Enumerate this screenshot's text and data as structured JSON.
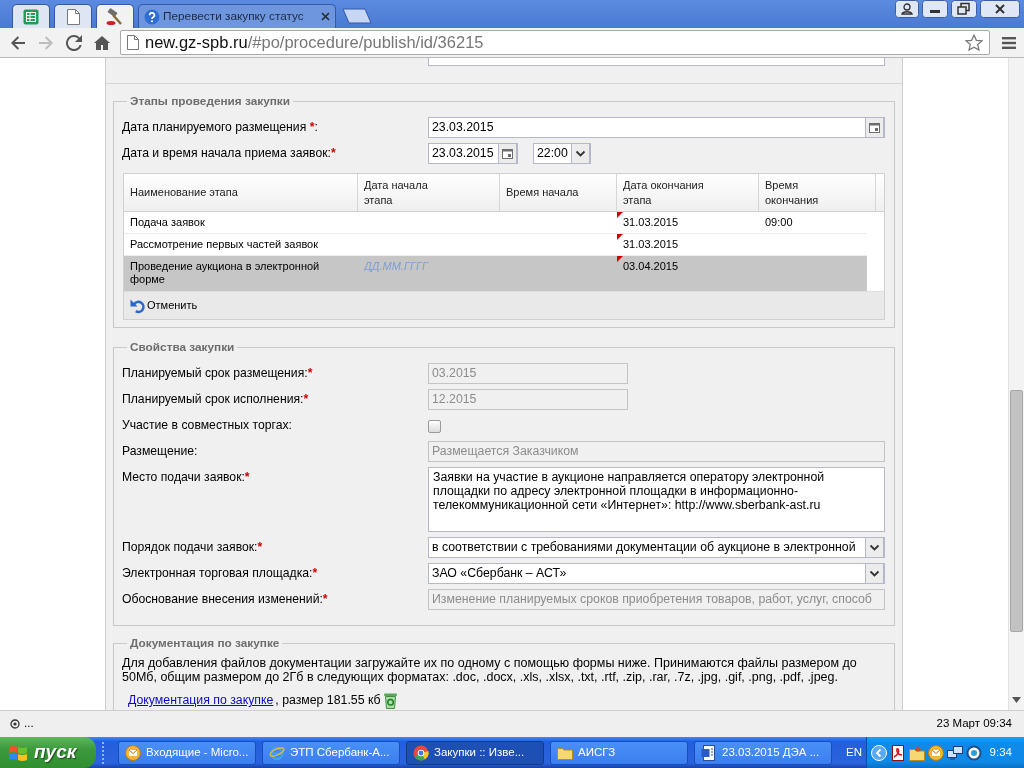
{
  "browser": {
    "tabs": [
      {
        "pinned": true,
        "selected": false
      },
      {
        "pinned": true,
        "selected": false
      },
      {
        "pinned": true,
        "selected": true
      },
      {
        "title": "Перевести закупку статус",
        "pinned": false,
        "selected": false
      }
    ],
    "navigation": {
      "back_disabled": false,
      "forward_disabled": true
    },
    "address": {
      "domain": "new.gz-spb.ru",
      "path": "/#po/procedure/publish/id/36215"
    }
  },
  "stages": {
    "legend": "Этапы проведения закупки",
    "fields": [
      {
        "kind": "date",
        "label": "Дата планируемого размещения",
        "required_mark": "*",
        "label_end": ":",
        "value": "23.03.2015"
      },
      {
        "kind": "datetime",
        "label": "Дата и время начала приема заявок:",
        "required_mark": "*",
        "value": "23.03.2015",
        "time": "22:00"
      }
    ],
    "table": {
      "columns": [
        "Наименование этапа",
        "Дата начала этапа",
        "Время начала",
        "Дата окончания этапа",
        "Время окончания"
      ],
      "rows": [
        {
          "name": "Подача заявок",
          "end_date": "31.03.2015",
          "end_time": "09:00",
          "edited": true,
          "selected": false
        },
        {
          "name": "Рассмотрение первых частей заявок",
          "end_date": "31.03.2015",
          "edited": true,
          "selected": false
        },
        {
          "name": "Проведение аукциона в электронной форме",
          "start_date_placeholder": "ДД.ММ.ГГГГ",
          "end_date": "03.04.2015",
          "edited": true,
          "selected": true
        }
      ]
    },
    "cancel_button": "Отменить"
  },
  "properties": {
    "legend": "Свойства закупки",
    "fields": [
      {
        "kind": "short_text",
        "label": "Планируемый срок размещения:",
        "required_mark": "*",
        "value": "03.2015",
        "disabled": true
      },
      {
        "kind": "short_text",
        "label": "Планируемый срок исполнения:",
        "required_mark": "*",
        "value": "12.2015",
        "disabled": true
      },
      {
        "kind": "checkbox",
        "label": "Участие в совместных торгах:",
        "checked": false,
        "disabled": false
      },
      {
        "kind": "text",
        "label": "Размещение:",
        "value": "Размещается Заказчиком",
        "disabled": true
      },
      {
        "kind": "textarea",
        "label": "Место подачи заявок:",
        "required_mark": "*",
        "value": "Заявки на участие в аукционе направляется оператору электронной площадки по адресу электронной площадки в информационно-телекоммуникационной сети «Интернет»: http://www.sberbank-ast.ru",
        "disabled": false
      },
      {
        "kind": "select",
        "label": "Порядок подачи заявок:",
        "required_mark": "*",
        "value": "в соответствии с требованиями документации об аукционе в электронной",
        "disabled": false
      },
      {
        "kind": "select",
        "label": "Электронная торговая площадка:",
        "required_mark": "*",
        "value": "ЗАО «Сбербанк – АСТ»",
        "disabled": false
      },
      {
        "kind": "text",
        "label": "Обоснование внесения изменений:",
        "required_mark": "*",
        "value": "Изменение планируемых сроков приобретения товаров, работ, услуг, способ",
        "disabled": true
      }
    ]
  },
  "documents": {
    "legend": "Документация по закупке",
    "text": "Для добавления файлов документации загружайте их по одному с помощью формы ниже. Принимаются файлы размером до 50Мб, общим размером до 2Гб в следующих форматах: .doc, .docx, .xls, .xlsx, .txt, .rtf, .zip, .rar, .7z, .jpg, .gif, .png, .pdf, .jpeg.",
    "link": "Документация по закупке",
    "link_suffix": ", размер 181.55 кб"
  },
  "status_bar": {
    "left": "...",
    "right": "23 Март 09:34"
  },
  "taskbar": {
    "start_label": "пуск",
    "tasks": [
      {
        "title": "Входящие - Micro...",
        "selected": false
      },
      {
        "title": "ЭТП Сбербанк-А...",
        "selected": false
      },
      {
        "title": "Закупки :: Изве...",
        "selected": true
      },
      {
        "title": "АИСГЗ",
        "selected": false
      },
      {
        "title": "23.03.2015 ДЭА ...",
        "selected": false
      }
    ],
    "language": "EN",
    "clock": "9:34"
  }
}
